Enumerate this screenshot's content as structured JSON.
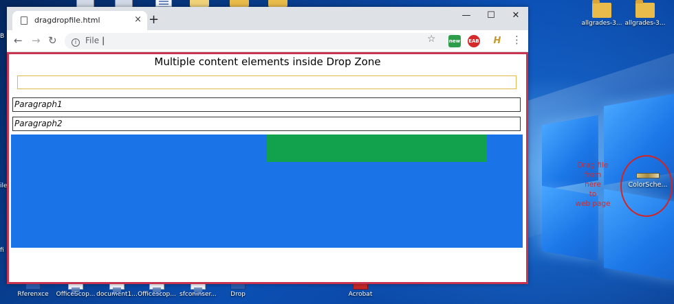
{
  "browser": {
    "tab_title": "dragdropfile.html",
    "tab_close": "×",
    "new_tab": "+",
    "window_controls": {
      "minimize": "—",
      "maximize": "☐",
      "close": "✕"
    },
    "nav": {
      "back": "←",
      "forward": "→",
      "reload": "↻"
    },
    "address": {
      "scheme_label": "File",
      "info_glyph": "i",
      "caret": "|"
    },
    "bookmark_star": "☆",
    "extensions": {
      "green": "new",
      "red": "EAB",
      "h": "H"
    },
    "menu_glyph": "⋮"
  },
  "page": {
    "title": "Multiple content elements inside Drop Zone",
    "input_value": "",
    "paragraph1": "Paragraph1",
    "paragraph2": "Paragraph2"
  },
  "desktop": {
    "top_right_icons": [
      "allgrades-3...",
      "allgrades-3..."
    ],
    "drag_note_lines": [
      "Drag file",
      "from",
      "here",
      "to",
      "web page"
    ],
    "drag_file_label": "ColorSche...",
    "bottom_icons": [
      "Rferenxce",
      "OfficeScop...",
      "document1...",
      "Officescop...",
      "sfconinser...",
      "Drop",
      "Acrobat"
    ],
    "left_edge_labels": [
      "B",
      "ile",
      "fi"
    ]
  },
  "colors": {
    "frame_border": "#c8344f",
    "drop_zone_blue": "#1a74e8",
    "drop_zone_green": "#12a24e",
    "input_border": "#e2b548",
    "annotation_red": "#d32323"
  }
}
